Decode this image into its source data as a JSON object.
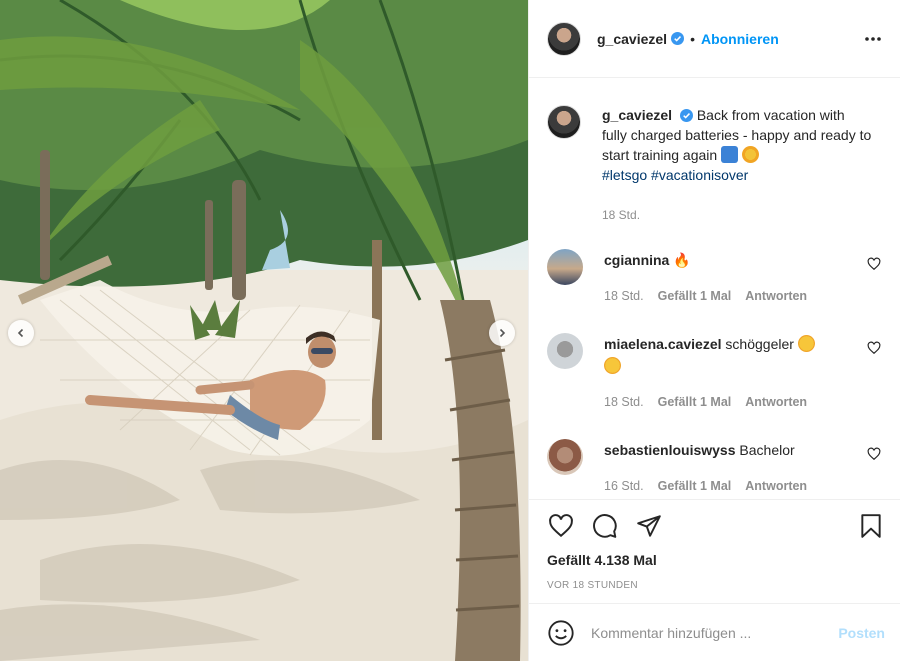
{
  "post": {
    "username": "g_caviezel",
    "follow_label": "Abonnieren",
    "separator": "•",
    "caption_text": "Back from vacation with fully charged batteries - happy and ready to start training again",
    "hashtags": [
      "#letsgo",
      "#vacationisover"
    ],
    "caption_time": "18 Std.",
    "likes": "Gefällt 4.138 Mal",
    "posted_ago": "VOR 18 STUNDEN"
  },
  "comments": [
    {
      "username": "cgiannina",
      "text": "🔥",
      "time": "18 Std.",
      "likes": "Gefällt 1 Mal",
      "reply": "Antworten"
    },
    {
      "username": "miaelena.caviezel",
      "text": "schöggeler",
      "time": "18 Std.",
      "likes": "Gefällt 1 Mal",
      "reply": "Antworten"
    },
    {
      "username": "sebastienlouiswyss",
      "text": "Bachelor",
      "time": "16 Std.",
      "likes": "Gefällt 1 Mal",
      "reply": "Antworten"
    }
  ],
  "add_comment": {
    "placeholder": "Kommentar hinzufügen ...",
    "post_label": "Posten"
  },
  "icons": {
    "verified": "verified-badge-icon",
    "more": "more-options-icon",
    "like": "heart-icon",
    "comment": "comment-bubble-icon",
    "share": "paper-plane-icon",
    "save": "bookmark-icon",
    "emoji": "smiley-icon",
    "carousel_prev": "chevron-left-icon",
    "carousel_next": "chevron-right-icon"
  },
  "colors": {
    "accent": "#0095f6",
    "post_disabled": "#b2dffc",
    "hashtag": "#00376b",
    "muted": "#8e8e8e"
  }
}
